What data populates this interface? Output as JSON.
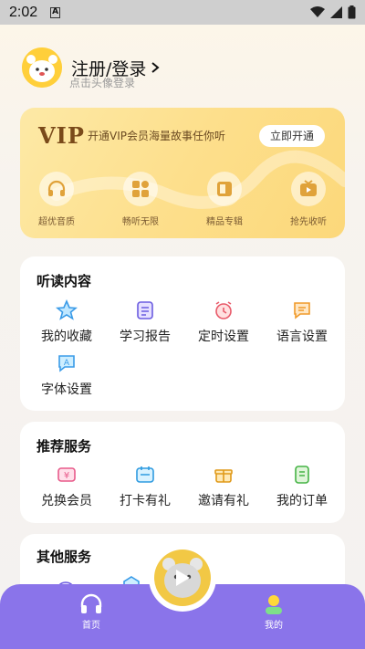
{
  "status_bar": {
    "time": "2:02",
    "notification_icon": "a-box-icon"
  },
  "profile": {
    "title": "注册/登录",
    "subtitle": "点击头像登录"
  },
  "vip": {
    "logo": "VIP",
    "description": "开通VIP会员海量故事任你听",
    "button": "立即开通",
    "features": [
      {
        "label": "超优音质",
        "icon": "headphones-icon"
      },
      {
        "label": "畅听无限",
        "icon": "apps-icon"
      },
      {
        "label": "精品专辑",
        "icon": "album-icon"
      },
      {
        "label": "抢先收听",
        "icon": "tv-play-icon"
      }
    ]
  },
  "listen": {
    "title": "听读内容",
    "items": [
      {
        "label": "我的收藏",
        "icon": "star-icon"
      },
      {
        "label": "学习报告",
        "icon": "report-icon"
      },
      {
        "label": "定时设置",
        "icon": "alarm-icon"
      },
      {
        "label": "语言设置",
        "icon": "chat-icon"
      },
      {
        "label": "字体设置",
        "icon": "font-icon"
      }
    ]
  },
  "services": {
    "title": "推荐服务",
    "items": [
      {
        "label": "兑换会员",
        "icon": "yen-icon"
      },
      {
        "label": "打卡有礼",
        "icon": "calendar-icon"
      },
      {
        "label": "邀请有礼",
        "icon": "gift-icon"
      },
      {
        "label": "我的订单",
        "icon": "order-icon"
      }
    ]
  },
  "other": {
    "title": "其他服务"
  },
  "tabbar": {
    "home": "首页",
    "mine": "我的"
  },
  "colors": {
    "accent": "#8a74ea",
    "vip": "#fddf8c",
    "brand_yellow": "#ffcf3a"
  }
}
